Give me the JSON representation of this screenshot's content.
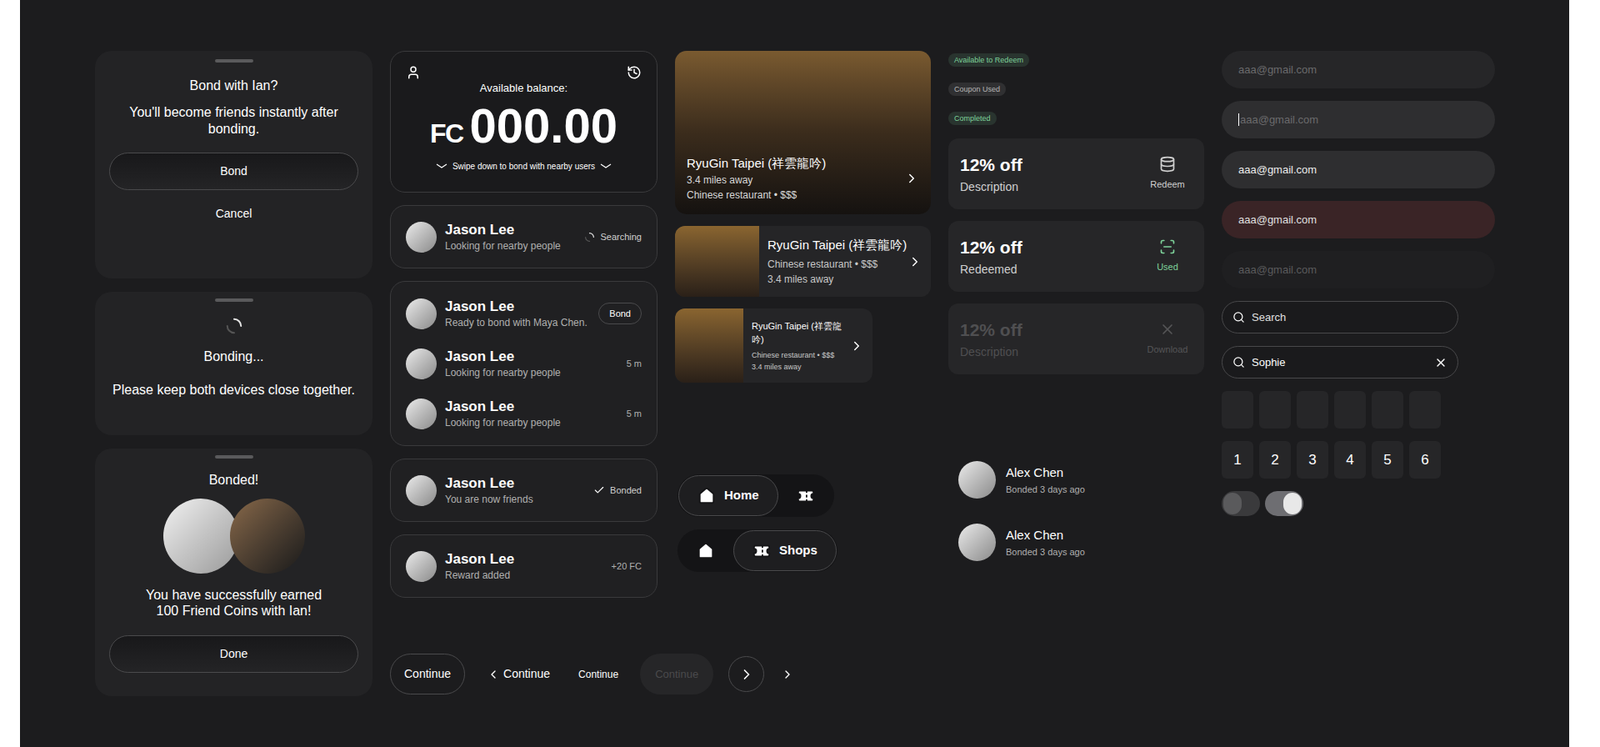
{
  "bond_sheets": [
    {
      "kind": "confirm",
      "title": "Bond with Ian?",
      "message": "You'll become friends instantly after bonding.",
      "primary": "Bond",
      "secondary": "Cancel"
    },
    {
      "kind": "loading",
      "title": "Bonding...",
      "message": "Please keep both devices close together."
    },
    {
      "kind": "success",
      "title": "Bonded!",
      "message": "You have successfully earned 100 Friend Coins with Ian!",
      "primary": "Done"
    }
  ],
  "balance": {
    "label": "Available balance:",
    "currency": "FC",
    "amount": "000.00",
    "hint": "Swipe down to bond with nearby users"
  },
  "person_cards": [
    [
      {
        "name": "Jason Lee",
        "status": "Looking for nearby people",
        "kind": "searching",
        "trailing": "Searching"
      }
    ],
    [
      {
        "name": "Jason Lee",
        "status": "Ready to bond with Maya Chen.",
        "kind": "action",
        "trailing": "Bond"
      },
      {
        "name": "Jason Lee",
        "status": "Looking for nearby people",
        "kind": "time",
        "trailing": "5 m"
      },
      {
        "name": "Jason Lee",
        "status": "Looking for nearby people",
        "kind": "time",
        "trailing": "5 m"
      }
    ],
    [
      {
        "name": "Jason Lee",
        "status": "You are now friends",
        "kind": "bonded",
        "trailing": "Bonded"
      }
    ],
    [
      {
        "name": "Jason Lee",
        "status": "Reward added",
        "kind": "reward",
        "trailing": "+20 FC"
      }
    ]
  ],
  "buttons": [
    {
      "kind": "outline",
      "label": "Continue",
      "disabled": false
    },
    {
      "kind": "back",
      "label": "Continue",
      "disabled": false
    },
    {
      "kind": "text",
      "label": "Continue",
      "disabled": false
    },
    {
      "kind": "filled",
      "label": "Continue",
      "disabled": true
    },
    {
      "kind": "circle",
      "disabled": false
    },
    {
      "kind": "chevron",
      "disabled": false
    }
  ],
  "restaurants": [
    {
      "size": "large",
      "name": "RyuGin Taipei (祥雲龍吟)",
      "lines": [
        "3.4 miles away",
        "Chinese restaurant • $$$"
      ]
    },
    {
      "size": "medium",
      "name": "RyuGin Taipei (祥雲龍吟)",
      "lines": [
        "Chinese restaurant • $$$",
        "3.4 miles away"
      ]
    },
    {
      "size": "small",
      "name": "RyuGin Taipei (祥雲龍吟)",
      "lines": [
        "Chinese restaurant • $$$",
        "3.4 miles away"
      ]
    }
  ],
  "nav_bars": [
    [
      {
        "kind": "home",
        "selected": true,
        "label": "Home"
      },
      {
        "kind": "shops",
        "selected": false
      }
    ],
    [
      {
        "kind": "home",
        "selected": false
      },
      {
        "kind": "shops",
        "selected": true,
        "label": "Shops"
      }
    ]
  ],
  "badges": [
    {
      "label": "Available to Redeem",
      "color": "#7ed29a"
    },
    {
      "label": "Coupon Used",
      "color": "#b5b5b5"
    },
    {
      "label": "Completed",
      "color": "#7ed29a"
    }
  ],
  "coupons": [
    {
      "title": "12% off",
      "subtitle": "Description",
      "action": "Redeem",
      "kind": "redeem",
      "disabled": false
    },
    {
      "title": "12% off",
      "subtitle": "Redeemed",
      "action": "Used",
      "kind": "used",
      "disabled": false
    },
    {
      "title": "12% off",
      "subtitle": "Description",
      "action": "Download",
      "kind": "download",
      "disabled": true
    }
  ],
  "friends": [
    {
      "name": "Alex Chen",
      "meta": "Bonded 3 days ago"
    },
    {
      "name": "Alex Chen",
      "meta": "Bonded 3 days ago"
    }
  ],
  "email_inputs": [
    {
      "text": "aaa@gmail.com",
      "state": "placeholder"
    },
    {
      "text": "aaa@gmail.com",
      "state": "focused"
    },
    {
      "text": "aaa@gmail.com",
      "state": "filled"
    },
    {
      "text": "aaa@gmail.com",
      "state": "error"
    },
    {
      "text": "aaa@gmail.com",
      "state": "disabled"
    }
  ],
  "search_fields": [
    {
      "text": "Search",
      "placeholder": true,
      "clearable": false
    },
    {
      "text": "Sophie",
      "placeholder": false,
      "clearable": true
    }
  ],
  "code_inputs": [
    [
      "",
      "",
      "",
      "",
      "",
      ""
    ],
    [
      "1",
      "2",
      "3",
      "4",
      "5",
      "6"
    ]
  ],
  "toggles": [
    {
      "on": false
    },
    {
      "on": true
    }
  ]
}
